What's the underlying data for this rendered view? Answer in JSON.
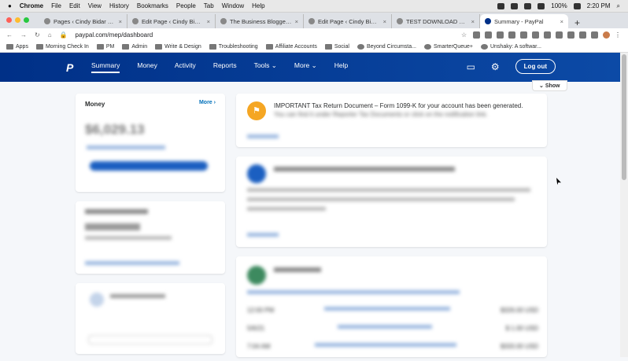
{
  "menubar": {
    "app": "Chrome",
    "items": [
      "File",
      "Edit",
      "View",
      "History",
      "Bookmarks",
      "People",
      "Tab",
      "Window",
      "Help"
    ],
    "battery": "100%",
    "time": "2:20 PM"
  },
  "tabs": [
    {
      "label": "Pages ‹ Cindy Bidar — Wo"
    },
    {
      "label": "Edit Page ‹ Cindy Bidar —"
    },
    {
      "label": "The Business Blogger's C"
    },
    {
      "label": "Edit Page ‹ Cindy Bidar —"
    },
    {
      "label": "TEST DOWNLOAD PAGE"
    },
    {
      "label": "Summary - PayPal",
      "active": true
    }
  ],
  "address": {
    "url": "paypal.com/mep/dashboard"
  },
  "bookmarks": [
    "Apps",
    "Morning Check In",
    "PM",
    "Admin",
    "Write & Design",
    "Troubleshooting",
    "Affiliate Accounts",
    "Social",
    "Beyond Circumsta...",
    "SmarterQueue+",
    "Unshaky: A softwar..."
  ],
  "paypal": {
    "nav": [
      "Summary",
      "Money",
      "Activity",
      "Reports",
      "Tools",
      "More",
      "Help"
    ],
    "logout": "Log out",
    "show": "Show",
    "money": {
      "title": "Money",
      "more": "More",
      "balance": "$6,029.13"
    },
    "notice": "IMPORTANT Tax Return Document – Form 1099-K for your account has been generated.",
    "notice2": "You can find it under Reporter Tax Documents or click on the notification link.",
    "activity": [
      {
        "date": "12:00 PM",
        "amount": "$326.00 USD"
      },
      {
        "date": "5/6/21",
        "amount": "$ 1.00 USD"
      },
      {
        "date": "7:04 AM",
        "amount": "$333.00 USD"
      }
    ]
  }
}
